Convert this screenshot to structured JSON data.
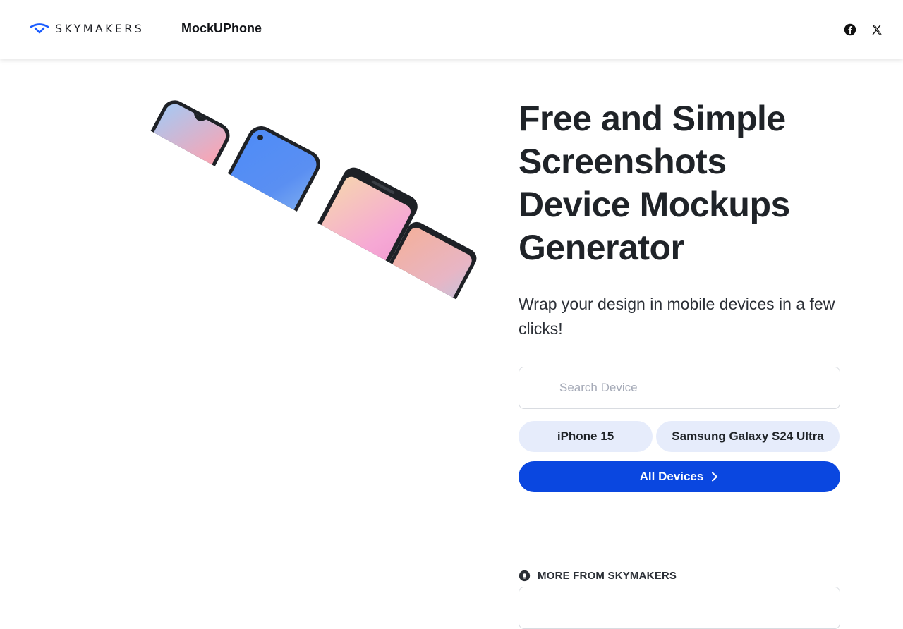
{
  "header": {
    "brand_name": "SKYMAKERS",
    "app_name": "MockUPhone",
    "brand_color": "#1a5cff",
    "social": [
      {
        "name": "facebook-icon"
      },
      {
        "name": "x-icon"
      }
    ]
  },
  "hero": {
    "title": "Free and Simple Screenshots Device Mockups Generator",
    "subtitle": "Wrap your design in mobile devices in a few clicks!"
  },
  "search": {
    "placeholder": "Search Device",
    "value": ""
  },
  "quick_devices": [
    {
      "label": "iPhone 15"
    },
    {
      "label": "Samsung Galaxy S24 Ultra"
    }
  ],
  "all_devices_label": "All Devices",
  "more": {
    "label": "MORE FROM SKYMAKERS"
  },
  "colors": {
    "accent": "#0a47e0",
    "chip_bg": "#e6ecfb"
  }
}
